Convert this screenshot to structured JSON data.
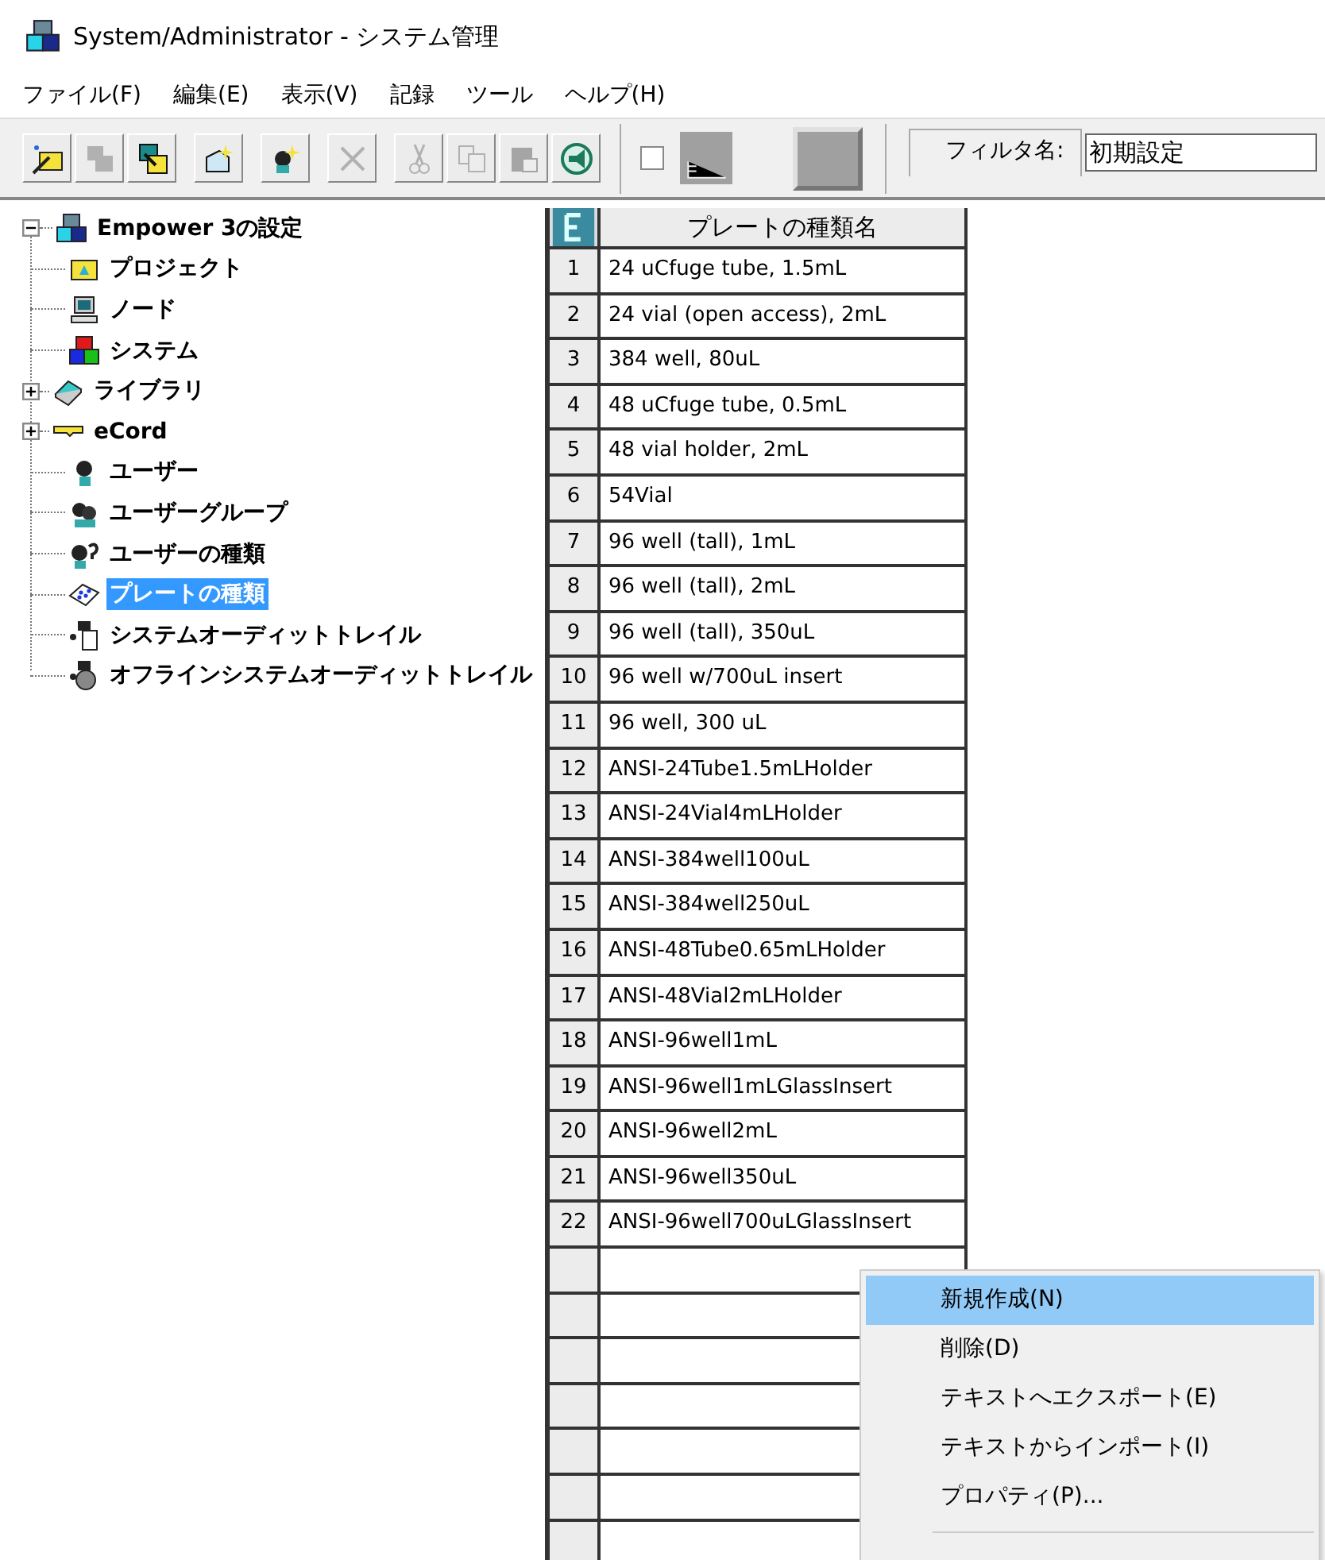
{
  "window": {
    "title": "System/Administrator - システム管理"
  },
  "menu_bar": [
    "ファイル(F)",
    "編集(E)",
    "表示(V)",
    "記録",
    "ツール",
    "ヘルプ(H)"
  ],
  "toolbar": [
    {
      "kind": "wand",
      "disabled": false
    },
    {
      "kind": "copy",
      "disabled": true
    },
    {
      "kind": "move",
      "disabled": false
    },
    {
      "kind": "newbox",
      "disabled": false
    },
    {
      "kind": "newuser",
      "disabled": false
    },
    {
      "kind": "delete",
      "disabled": true
    },
    {
      "kind": "cut",
      "disabled": true
    },
    {
      "kind": "pages",
      "disabled": true
    },
    {
      "kind": "paste",
      "disabled": true
    },
    {
      "kind": "megaphone",
      "disabled": false
    }
  ],
  "view_checkbox": {
    "checked": false
  },
  "filter": {
    "label": "フィルタ名:",
    "value": "初期設定"
  },
  "tree": {
    "label": "Empower 3の設定",
    "kind": "system",
    "expanded": true,
    "selected": false,
    "children": [
      {
        "label": "プロジェクト",
        "kind": "project",
        "selected": false
      },
      {
        "label": "ノード",
        "kind": "node",
        "selected": false
      },
      {
        "label": "システム",
        "kind": "system",
        "selected": false
      },
      {
        "label": "ライブラリ",
        "kind": "library",
        "expanded": false,
        "selected": false
      },
      {
        "label": "eCord",
        "kind": "key",
        "expanded": false,
        "selected": false
      },
      {
        "label": "ユーザー",
        "kind": "user",
        "selected": false
      },
      {
        "label": "ユーザーグループ",
        "kind": "group",
        "selected": false
      },
      {
        "label": "ユーザーの種類",
        "kind": "usertype",
        "selected": false
      },
      {
        "label": "プレートの種類",
        "kind": "plate",
        "selected": true
      },
      {
        "label": "システムオーディットトレイル",
        "kind": "audit",
        "selected": false
      },
      {
        "label": "オフラインシステムオーディットトレイル",
        "kind": "offline",
        "selected": false
      }
    ]
  },
  "table": {
    "columns": [
      "プレートの種類名"
    ],
    "rows": [
      {
        "num": "1",
        "name": "24 uCfuge tube, 1.5mL"
      },
      {
        "num": "2",
        "name": "24 vial (open access), 2mL"
      },
      {
        "num": "3",
        "name": "384 well, 80uL"
      },
      {
        "num": "4",
        "name": "48 uCfuge tube, 0.5mL"
      },
      {
        "num": "5",
        "name": "48 vial holder, 2mL"
      },
      {
        "num": "6",
        "name": "54Vial"
      },
      {
        "num": "7",
        "name": "96 well (tall), 1mL"
      },
      {
        "num": "8",
        "name": "96 well (tall), 2mL"
      },
      {
        "num": "9",
        "name": "96 well (tall), 350uL"
      },
      {
        "num": "10",
        "name": "96 well w/700uL insert"
      },
      {
        "num": "11",
        "name": "96 well, 300 uL"
      },
      {
        "num": "12",
        "name": "ANSI-24Tube1.5mLHolder"
      },
      {
        "num": "13",
        "name": "ANSI-24Vial4mLHolder"
      },
      {
        "num": "14",
        "name": "ANSI-384well100uL"
      },
      {
        "num": "15",
        "name": "ANSI-384well250uL"
      },
      {
        "num": "16",
        "name": "ANSI-48Tube0.65mLHolder"
      },
      {
        "num": "17",
        "name": "ANSI-48Vial2mLHolder"
      },
      {
        "num": "18",
        "name": "ANSI-96well1mL"
      },
      {
        "num": "19",
        "name": "ANSI-96well1mLGlassInsert"
      },
      {
        "num": "20",
        "name": "ANSI-96well2mL"
      },
      {
        "num": "21",
        "name": "ANSI-96well350uL"
      },
      {
        "num": "22",
        "name": "ANSI-96well700uLGlassInsert"
      }
    ]
  },
  "context_menu": [
    {
      "label": "新規作成(N)",
      "selected": true
    },
    {
      "label": "削除(D)",
      "selected": false
    },
    {
      "label": "テキストへエクスポート(E)",
      "selected": false
    },
    {
      "label": "テキストからインポート(I)",
      "selected": false
    },
    {
      "label": "プロパティ(P)...",
      "selected": false
    }
  ]
}
